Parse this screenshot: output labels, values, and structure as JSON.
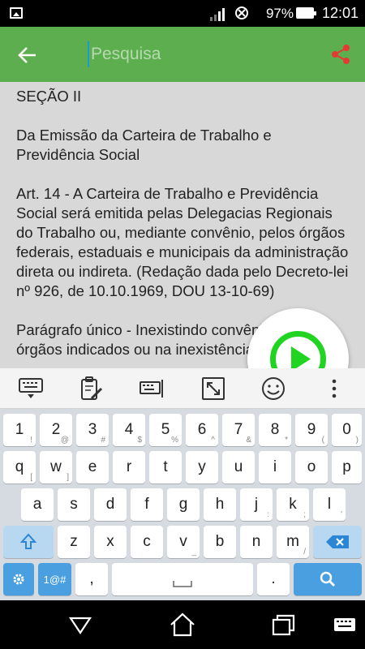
{
  "status_bar": {
    "battery_percent": "97%",
    "time": "12:01"
  },
  "app_bar": {
    "search_placeholder": "Pesquisa",
    "search_value": "",
    "accent_color": "#5cae4e",
    "share_color": "#e53935"
  },
  "document": {
    "paragraphs": [
      "SEÇÃO II",
      "Da Emissão da Carteira de Trabalho e Previdência Social",
      "Art. 14 - A Carteira de Trabalho e Previdência Social será emitida pelas Delegacias Regionais do Trabalho ou, mediante convênio, pelos órgãos federais, estaduais e municipais da administração direta ou indireta. (Redação dada pelo Decreto-lei nº 926, de 10.10.1969, DOU 13-10-69)",
      "Parágrafo único - Inexistindo convênio com os órgãos indicados ou na inexistência"
    ]
  },
  "play_button": {
    "icon": "play-icon",
    "color": "#22d422"
  },
  "keyboard": {
    "toolbar_icons": [
      "keyboard-hide-icon",
      "clipboard-edit-icon",
      "keyboard-settings-icon",
      "resize-icon",
      "emoji-icon",
      "more-vert-icon"
    ],
    "row_numbers": [
      {
        "main": "1",
        "sub": "!"
      },
      {
        "main": "2",
        "sub": "@"
      },
      {
        "main": "3",
        "sub": "#"
      },
      {
        "main": "4",
        "sub": "$"
      },
      {
        "main": "5",
        "sub": "%"
      },
      {
        "main": "6",
        "sub": "^"
      },
      {
        "main": "7",
        "sub": "&"
      },
      {
        "main": "8",
        "sub": "*"
      },
      {
        "main": "9",
        "sub": "("
      },
      {
        "main": "0",
        "sub": ")"
      }
    ],
    "row_q": [
      {
        "main": "q",
        "sub": "["
      },
      {
        "main": "w",
        "sub": "]"
      },
      {
        "main": "e",
        "sub": ""
      },
      {
        "main": "r",
        "sub": ""
      },
      {
        "main": "t",
        "sub": ""
      },
      {
        "main": "y",
        "sub": ""
      },
      {
        "main": "u",
        "sub": ""
      },
      {
        "main": "i",
        "sub": ""
      },
      {
        "main": "o",
        "sub": ""
      },
      {
        "main": "p",
        "sub": ""
      }
    ],
    "row_a": [
      {
        "main": "a",
        "sub": ""
      },
      {
        "main": "s",
        "sub": ""
      },
      {
        "main": "d",
        "sub": ""
      },
      {
        "main": "f",
        "sub": ""
      },
      {
        "main": "g",
        "sub": ""
      },
      {
        "main": "h",
        "sub": ""
      },
      {
        "main": "j",
        "sub": ":"
      },
      {
        "main": "k",
        "sub": ";"
      },
      {
        "main": "l",
        "sub": "'"
      }
    ],
    "row_z": [
      {
        "main": "z",
        "sub": ""
      },
      {
        "main": "x",
        "sub": ""
      },
      {
        "main": "c",
        "sub": ""
      },
      {
        "main": "v",
        "sub": "_"
      },
      {
        "main": "b",
        "sub": ""
      },
      {
        "main": "n",
        "sub": ""
      },
      {
        "main": "m",
        "sub": "/"
      }
    ],
    "bottom": {
      "symbols_label": "1@#",
      "comma_label": ",",
      "period_label": ".",
      "space_icon": "space-bar-icon",
      "settings_icon": "gear-icon",
      "search_icon": "search-icon",
      "backspace_icon": "backspace-icon",
      "shift_icon": "shift-icon"
    }
  },
  "nav_bar": {
    "icons": [
      "back-triangle-icon",
      "home-icon",
      "recents-icon",
      "keyboard-switch-icon"
    ]
  }
}
